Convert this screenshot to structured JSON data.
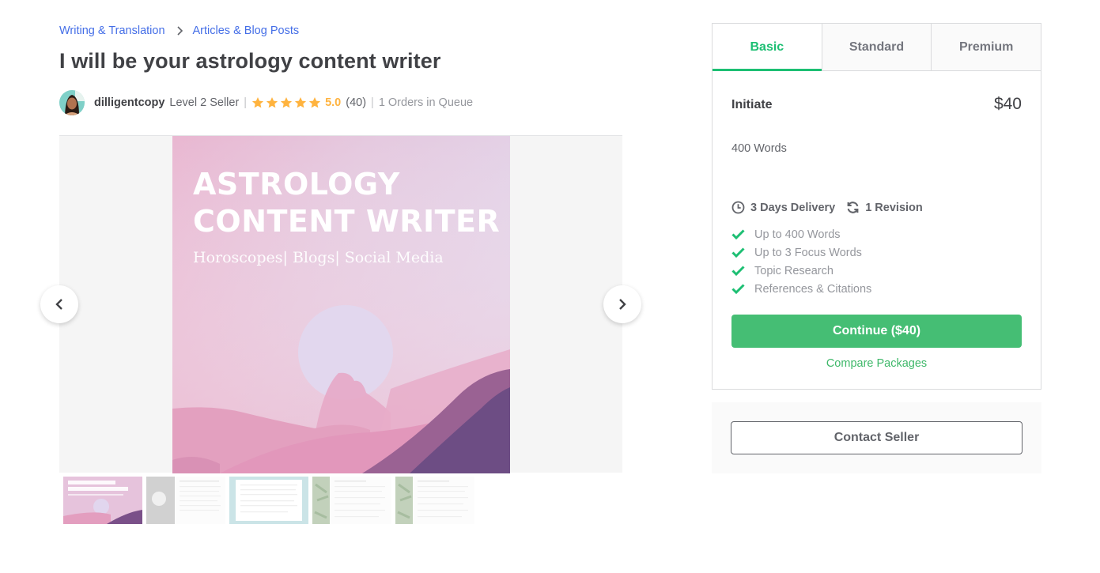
{
  "breadcrumb": {
    "items": [
      "Writing & Translation",
      "Articles & Blog Posts"
    ],
    "separator_icon": "chevron-right-icon"
  },
  "gig": {
    "title": "I will be your astrology content writer"
  },
  "seller": {
    "username": "dilligentcopy",
    "level": "Level 2 Seller",
    "stars": 5,
    "rating": "5.0",
    "review_count": "(40)",
    "queue": "1 Orders in Queue"
  },
  "gallery": {
    "main_image": {
      "heading_line1": "ASTROLOGY",
      "heading_line2": "CONTENT WRITER",
      "subheading": "Horoscopes| Blogs| Social Media"
    },
    "prev_icon": "chevron-left-icon",
    "next_icon": "chevron-right-icon",
    "thumbnails": [
      {
        "kind": "astrology-cover",
        "selected": true
      },
      {
        "kind": "document-with-photo",
        "selected": false
      },
      {
        "kind": "framed-document",
        "selected": false
      },
      {
        "kind": "document-with-leaves",
        "selected": false
      },
      {
        "kind": "document-with-leaves",
        "selected": false
      }
    ]
  },
  "packages": {
    "tabs": [
      {
        "label": "Basic",
        "active": true
      },
      {
        "label": "Standard",
        "active": false
      },
      {
        "label": "Premium",
        "active": false
      }
    ],
    "selected": {
      "name": "Initiate",
      "price": "$40",
      "description": "400 Words",
      "delivery": "3 Days Delivery",
      "revisions": "1 Revision",
      "features": [
        "Up to 400 Words",
        "Up to 3 Focus Words",
        "Topic Research",
        "References & Citations"
      ]
    },
    "continue_label": "Continue ($40)",
    "compare_label": "Compare Packages"
  },
  "contact": {
    "button_label": "Contact Seller"
  },
  "colors": {
    "accent_green": "#1dbf73",
    "button_green": "#45be74",
    "link_blue": "#446ee7",
    "star_gold": "#ffb33e"
  }
}
